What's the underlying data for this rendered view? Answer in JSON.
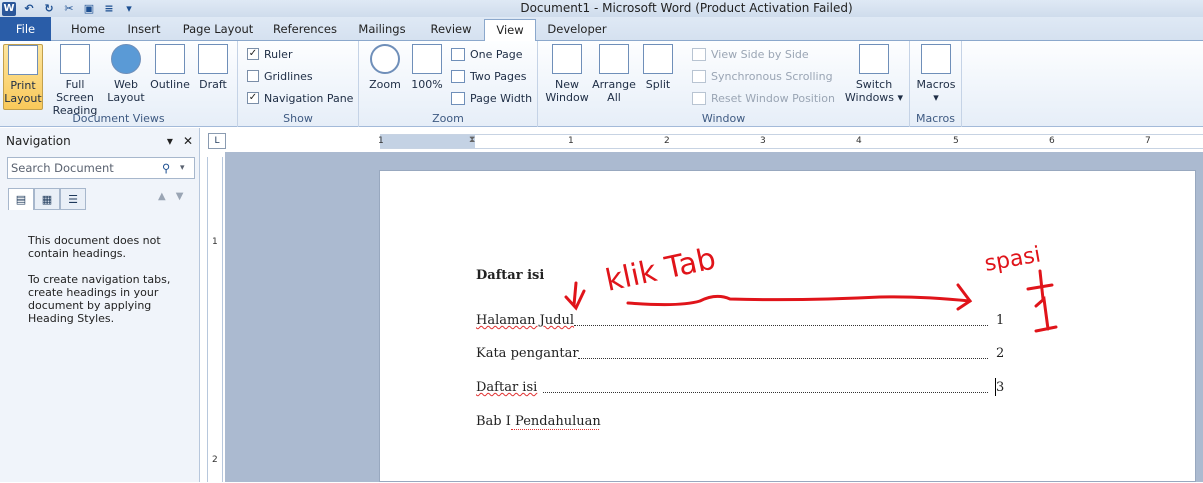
{
  "window": {
    "title": "Document1  -  Microsoft Word (Product Activation Failed)"
  },
  "tabs": [
    "File",
    "Home",
    "Insert",
    "Page Layout",
    "References",
    "Mailings",
    "Review",
    "View",
    "Developer"
  ],
  "ribbon": {
    "document_views": {
      "label": "Document Views",
      "print_layout": "Print Layout",
      "full_screen": "Full Screen Reading",
      "web_layout": "Web Layout",
      "outline": "Outline",
      "draft": "Draft"
    },
    "show": {
      "label": "Show",
      "ruler": "Ruler",
      "gridlines": "Gridlines",
      "navigation_pane": "Navigation Pane",
      "ruler_checked": true,
      "gridlines_checked": false,
      "navpane_checked": true
    },
    "zoom": {
      "label": "Zoom",
      "zoom": "Zoom",
      "percent": "100%",
      "one_page": "One Page",
      "two_pages": "Two Pages",
      "page_width": "Page Width"
    },
    "window": {
      "label": "Window",
      "new_window": "New Window",
      "arrange_all": "Arrange All",
      "split": "Split",
      "view_side_by_side": "View Side by Side",
      "sync_scrolling": "Synchronous Scrolling",
      "reset_window": "Reset Window Position",
      "switch_windows": "Switch Windows"
    },
    "macros": {
      "label": "Macros",
      "macros": "Macros"
    }
  },
  "navigation": {
    "title": "Navigation",
    "search_placeholder": "Search Document",
    "msg1": "This document does not contain headings.",
    "msg2": "To create navigation tabs, create headings in your document by applying Heading Styles."
  },
  "ruler": {
    "numbers": [
      "1",
      "1",
      "2",
      "3",
      "4",
      "5",
      "6",
      "7"
    ]
  },
  "vruler": {
    "numbers": [
      "1",
      "2"
    ]
  },
  "document": {
    "heading": "Daftar isi",
    "entries": [
      {
        "text": "Halaman Judul",
        "page": "1"
      },
      {
        "text": "Kata pengantar",
        "page": "2"
      },
      {
        "text": "Daftar isi",
        "page": "3"
      }
    ],
    "last_line": "Bab I Pendahuluan"
  },
  "annotations": {
    "klik_tab": "klik Tab",
    "spasi": "spasi",
    "plus": "+",
    "one": "1"
  }
}
